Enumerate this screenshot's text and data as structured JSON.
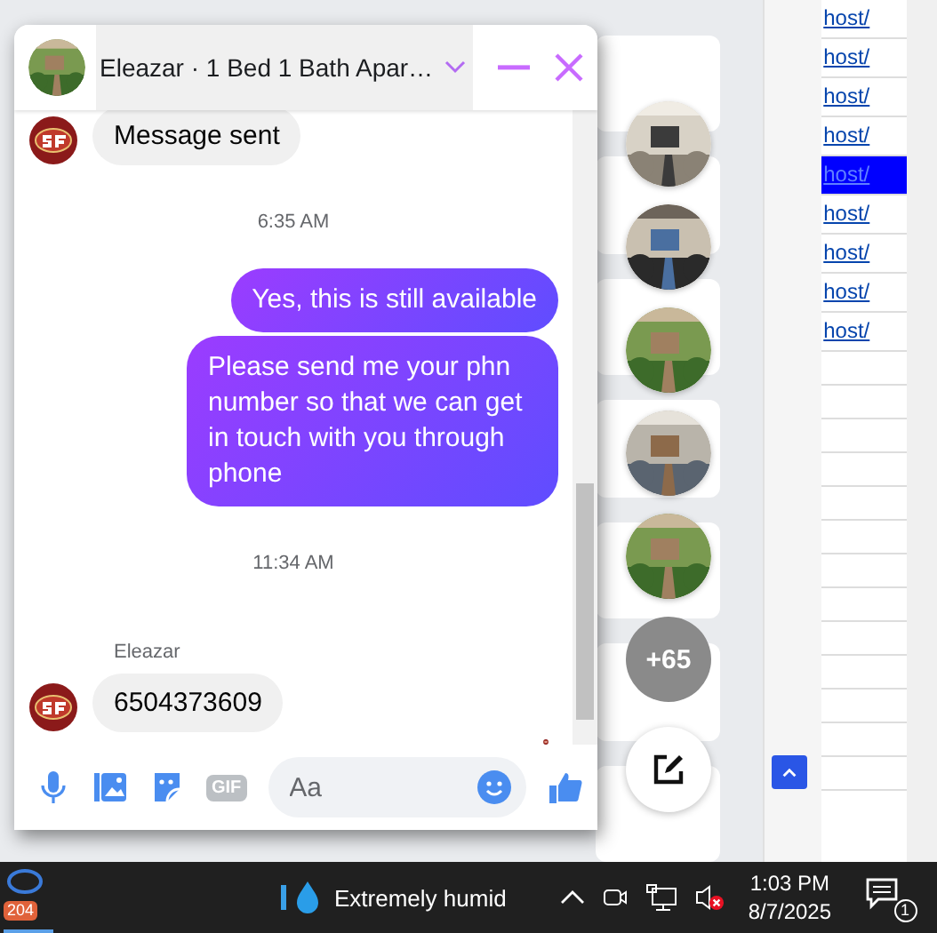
{
  "chat": {
    "title": "Eleazar · 1 Bed 1 Bath Apar…",
    "messages": [
      {
        "kind": "incoming",
        "text": "Message sent"
      },
      {
        "kind": "time",
        "text": "6:35 AM"
      },
      {
        "kind": "outgoing",
        "text": "Yes, this is still available"
      },
      {
        "kind": "outgoing",
        "text": "Please send me your phn number so that we can get in touch with you through phone"
      },
      {
        "kind": "time",
        "text": "11:34 AM"
      },
      {
        "kind": "sender",
        "text": "Eleazar"
      },
      {
        "kind": "incoming",
        "text": "6504373609"
      },
      {
        "kind": "seen"
      }
    ],
    "gif_label": "GIF",
    "composer": {
      "placeholder": "Aa"
    }
  },
  "chat_heads": [
    {
      "kind": "picture"
    },
    {
      "kind": "picture"
    },
    {
      "kind": "picture"
    },
    {
      "kind": "picture"
    },
    {
      "kind": "picture"
    },
    {
      "kind": "more",
      "text": "+65"
    }
  ],
  "links": [
    {
      "text": "host/",
      "selected": false
    },
    {
      "text": "host/",
      "selected": false
    },
    {
      "text": "host/",
      "selected": false
    },
    {
      "text": "host/",
      "selected": false
    },
    {
      "text": "host/",
      "selected": true
    },
    {
      "text": "host/",
      "selected": false
    },
    {
      "text": "host/",
      "selected": false
    },
    {
      "text": "host/",
      "selected": false
    },
    {
      "text": "host/",
      "selected": false
    }
  ],
  "taskbar": {
    "badge": "204",
    "weather": "Extremely humid",
    "time": "1:03 PM",
    "date": "8/7/2025",
    "notifications": "1"
  }
}
